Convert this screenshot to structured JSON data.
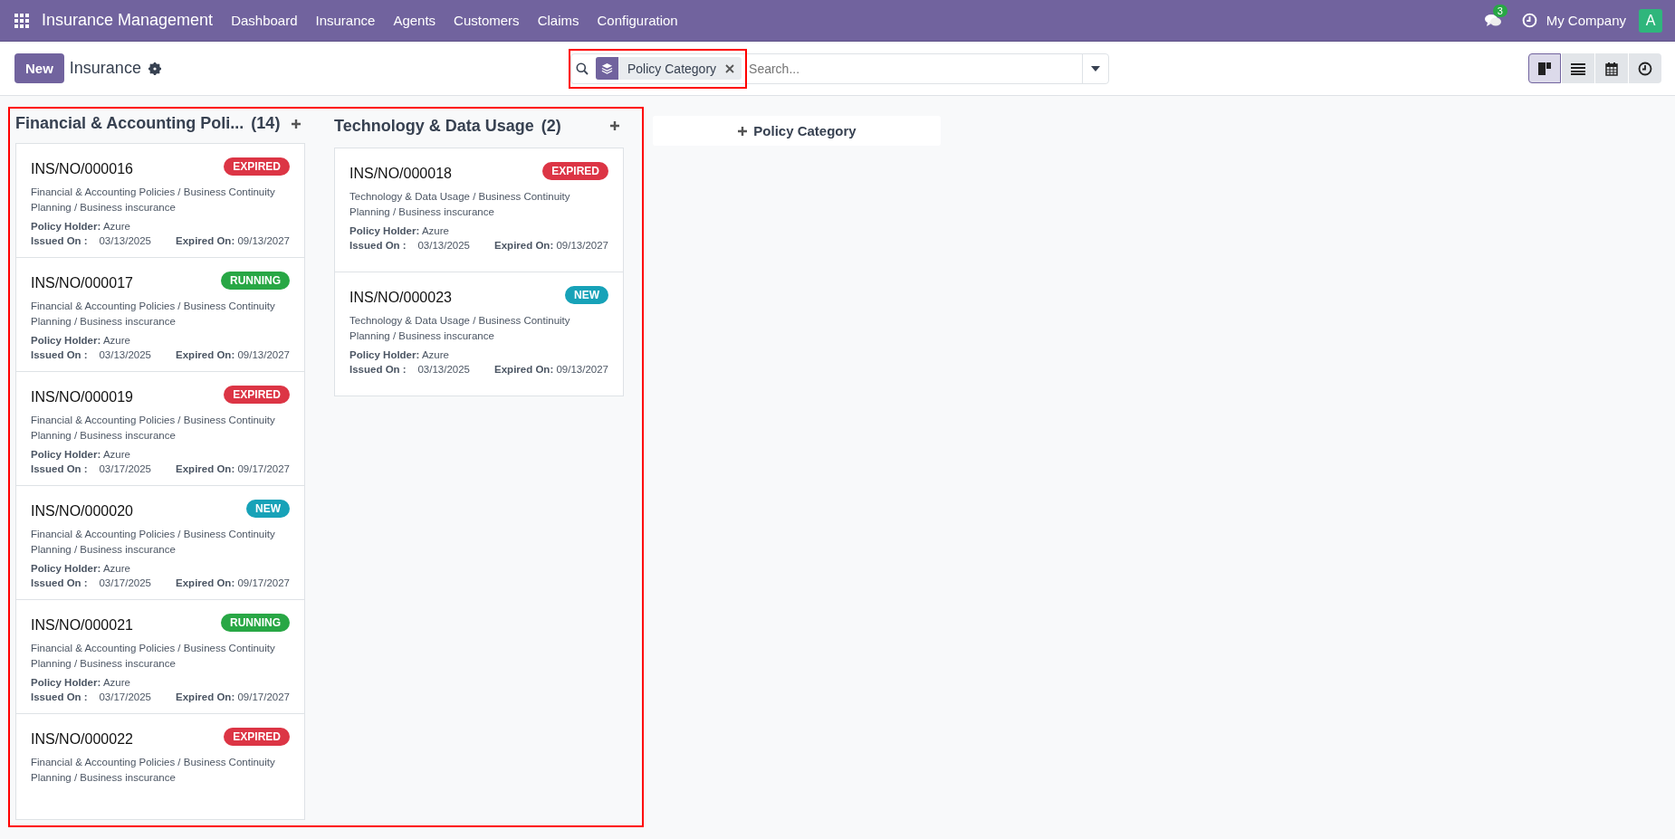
{
  "navbar": {
    "app_name": "Insurance Management",
    "menu": [
      "Dashboard",
      "Insurance",
      "Agents",
      "Customers",
      "Claims",
      "Configuration"
    ],
    "message_count": "3",
    "company": "My Company",
    "avatar_letter": "A"
  },
  "control_panel": {
    "new_button": "New",
    "breadcrumb": "Insurance",
    "search": {
      "highlighted": true,
      "facet": "Policy Category",
      "placeholder": "Search..."
    },
    "views": [
      {
        "kind": "kanban",
        "selected": true
      },
      {
        "kind": "list",
        "selected": false
      },
      {
        "kind": "calendar",
        "selected": false
      },
      {
        "kind": "activity",
        "selected": false
      }
    ]
  },
  "kanban": {
    "highlighted": true,
    "columns": [
      {
        "title": "Financial & Accounting Poli...",
        "count": "(14)",
        "cards": [
          {
            "ref": "INS/NO/000016",
            "status": "EXPIRED",
            "color": "#dc3545",
            "description": "Financial & Accounting Policies / Business Continuity Planning / Business inscurance",
            "holder_label": "Policy Holder:",
            "holder": "Azure",
            "issued_label": "Issued On :",
            "issued": "03/13/2025",
            "expiry_label": "Expired On:",
            "expiry": "09/13/2027"
          },
          {
            "ref": "INS/NO/000017",
            "status": "RUNNING",
            "color": "#28a745",
            "description": "Financial & Accounting Policies / Business Continuity Planning / Business inscurance",
            "holder_label": "Policy Holder:",
            "holder": "Azure",
            "issued_label": "Issued On :",
            "issued": "03/13/2025",
            "expiry_label": "Expired On:",
            "expiry": "09/13/2027"
          },
          {
            "ref": "INS/NO/000019",
            "status": "EXPIRED",
            "color": "#dc3545",
            "description": "Financial & Accounting Policies / Business Continuity Planning / Business inscurance",
            "holder_label": "Policy Holder:",
            "holder": "Azure",
            "issued_label": "Issued On :",
            "issued": "03/17/2025",
            "expiry_label": "Expired On:",
            "expiry": "09/17/2027"
          },
          {
            "ref": "INS/NO/000020",
            "status": "NEW",
            "color": "#17a2b8",
            "description": "Financial & Accounting Policies / Business Continuity Planning / Business inscurance",
            "holder_label": "Policy Holder:",
            "holder": "Azure",
            "issued_label": "Issued On :",
            "issued": "03/17/2025",
            "expiry_label": "Expired On:",
            "expiry": "09/17/2027"
          },
          {
            "ref": "INS/NO/000021",
            "status": "RUNNING",
            "color": "#28a745",
            "description": "Financial & Accounting Policies / Business Continuity Planning / Business inscurance",
            "holder_label": "Policy Holder:",
            "holder": "Azure",
            "issued_label": "Issued On :",
            "issued": "03/17/2025",
            "expiry_label": "Expired On:",
            "expiry": "09/17/2027"
          },
          {
            "ref": "INS/NO/000022",
            "status": "EXPIRED",
            "color": "#dc3545",
            "description": "Financial & Accounting Policies / Business Continuity Planning / Business inscurance"
          }
        ]
      },
      {
        "title": "Technology & Data Usage",
        "count": "(2)",
        "cards": [
          {
            "ref": "INS/NO/000018",
            "status": "EXPIRED",
            "color": "#dc3545",
            "description": "Technology & Data Usage / Business Continuity Planning / Business inscurance",
            "holder_label": "Policy Holder:",
            "holder": "Azure",
            "issued_label": "Issued On :",
            "issued": "03/13/2025",
            "expiry_label": "Expired On:",
            "expiry": "09/13/2027"
          },
          {
            "ref": "INS/NO/000023",
            "status": "NEW",
            "color": "#17a2b8",
            "description": "Technology & Data Usage / Business Continuity Planning / Business inscurance",
            "holder_label": "Policy Holder:",
            "holder": "Azure",
            "issued_label": "Issued On :",
            "issued": "03/13/2025",
            "expiry_label": "Expired On:",
            "expiry": "09/13/2027"
          }
        ]
      }
    ],
    "quick_create": "Policy Category"
  }
}
